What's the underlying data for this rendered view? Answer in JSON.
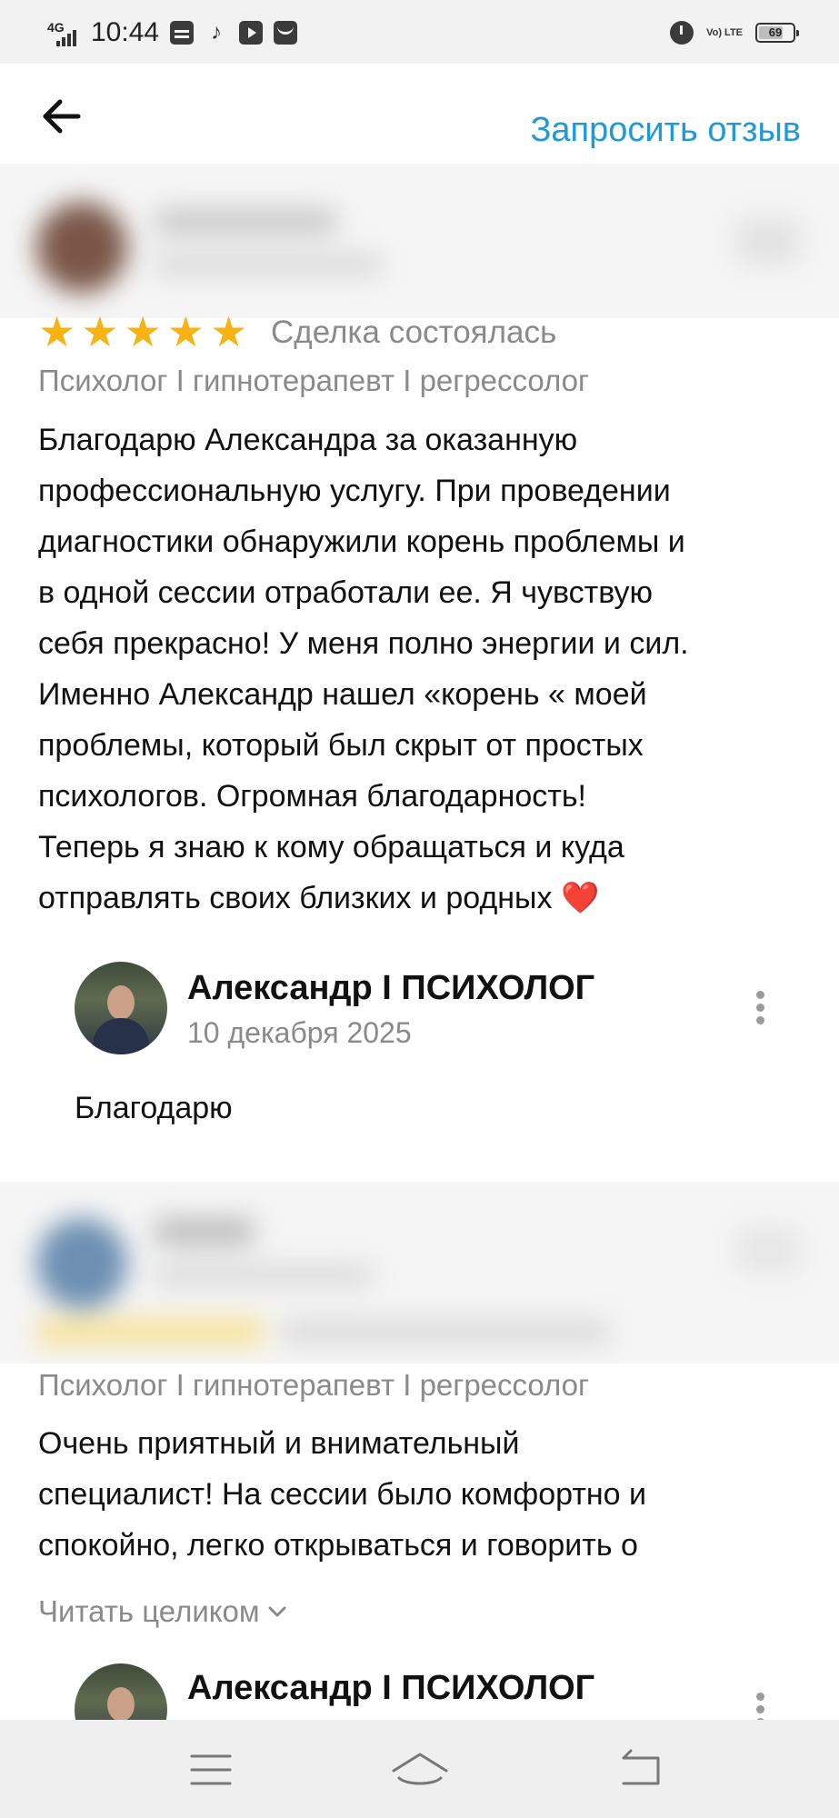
{
  "status_bar": {
    "network": "4G",
    "time": "10:44",
    "volte": "Vo) LTE",
    "battery": "69"
  },
  "header": {
    "request_review_label": "Запросить отзыв"
  },
  "reviews": [
    {
      "rating": 5,
      "deal_status": "Сделка состоялась",
      "service": "Психолог I гипнотерапевт I регрессолог",
      "text": "Благодарю Александра за оказанную\nпрофессиональную услугу.  При проведении\nдиагностики обнаружили корень проблемы и\nв одной сессии отработали ее. Я чувствую\nсебя прекрасно! У меня полно энергии и сил.\nИменно Александр нашел «корень « моей\nпроблемы, который был скрыт от простых\nпсихологов.  Огромная благодарность!\nТеперь я знаю к кому обращаться и куда\nотправлять своих близких и родных ❤️",
      "reply": {
        "author": "Александр I ПСИХОЛОГ",
        "date": "10 декабря 2025",
        "text": "Благодарю"
      }
    },
    {
      "service": "Психолог I гипнотерапевт I регрессолог",
      "text": "Очень приятный и внимательный\nспециалист! На сессии было комфортно и\nспокойно, легко открываться и говорить о",
      "read_more": "Читать целиком",
      "reply": {
        "author": "Александр I ПСИХОЛОГ"
      }
    }
  ],
  "icons": {
    "back": "arrow-left-icon",
    "more": "more-vertical-icon",
    "chevron": "chevron-down-icon",
    "heart": "heart-icon"
  },
  "colors": {
    "accent": "#1f9ad6",
    "star": "#f6b313",
    "muted": "#8a8a8a"
  }
}
